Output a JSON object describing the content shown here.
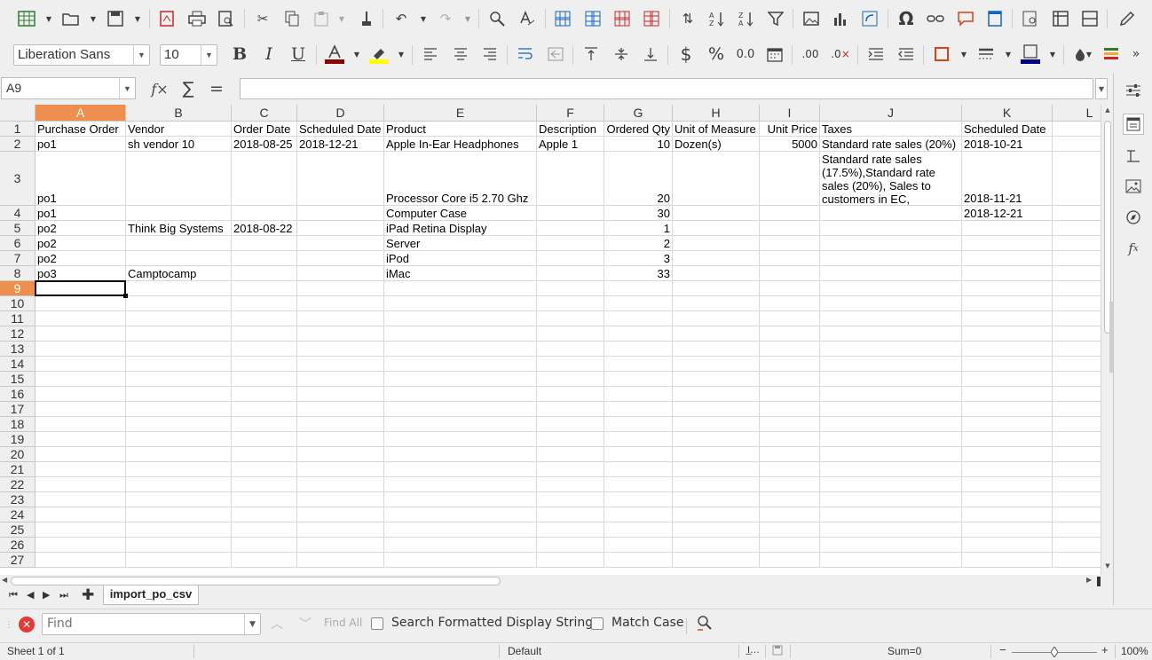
{
  "toolbar": {
    "font_name": "Liberation Sans",
    "font_size": "10"
  },
  "formula_bar": {
    "name_box": "A9",
    "function_wizard_glyph": "f×",
    "sum_glyph": "∑",
    "formula_glyph": "=",
    "content": ""
  },
  "sheet": {
    "columns": [
      "A",
      "B",
      "C",
      "D",
      "E",
      "F",
      "G",
      "H",
      "I",
      "J",
      "K",
      "L"
    ],
    "selected_column": "A",
    "selected_row": "9",
    "rows": [
      {
        "num": "1",
        "cells": [
          "Purchase Order",
          "Vendor",
          "Order Date",
          "Scheduled Date",
          "Product",
          "Description",
          "Ordered Qty",
          "Unit of Measure",
          "Unit Price",
          "Taxes",
          "Scheduled Date",
          ""
        ]
      },
      {
        "num": "2",
        "cells": [
          "po1",
          "sh vendor 10",
          "2018-08-25",
          "2018-12-21",
          "Apple In-Ear Headphones",
          "Apple 1",
          "10",
          "Dozen(s)",
          "5000",
          "Standard rate sales (20%)",
          "2018-10-21",
          ""
        ]
      },
      {
        "num": "3",
        "cells": [
          "po1",
          "",
          "",
          "",
          "Processor Core i5 2.70 Ghz",
          "",
          "20",
          "",
          "",
          "Standard rate sales (17.5%),Standard rate sales (20%),   Sales to customers in EC,",
          "2018-11-21",
          ""
        ]
      },
      {
        "num": "4",
        "cells": [
          "po1",
          "",
          "",
          "",
          "Computer Case",
          "",
          "30",
          "",
          "",
          "",
          "2018-12-21",
          ""
        ]
      },
      {
        "num": "5",
        "cells": [
          "po2",
          "Think Big Systems",
          "2018-08-22",
          "",
          "iPad Retina Display",
          "",
          "1",
          "",
          "",
          "",
          "",
          ""
        ]
      },
      {
        "num": "6",
        "cells": [
          "po2",
          "",
          "",
          "",
          "Server",
          "",
          "2",
          "",
          "",
          "",
          "",
          ""
        ]
      },
      {
        "num": "7",
        "cells": [
          "po2",
          "",
          "",
          "",
          "iPod",
          "",
          "3",
          "",
          "",
          "",
          "",
          ""
        ]
      },
      {
        "num": "8",
        "cells": [
          "po3",
          "Camptocamp",
          "",
          "",
          "iMac",
          "",
          "33",
          "",
          "",
          "",
          "",
          ""
        ]
      },
      {
        "num": "9",
        "cells": [
          "",
          "",
          "",
          "",
          "",
          "",
          "",
          "",
          "",
          "",
          "",
          ""
        ]
      },
      {
        "num": "10",
        "cells": []
      },
      {
        "num": "11",
        "cells": []
      },
      {
        "num": "12",
        "cells": []
      },
      {
        "num": "13",
        "cells": []
      },
      {
        "num": "14",
        "cells": []
      },
      {
        "num": "15",
        "cells": []
      },
      {
        "num": "16",
        "cells": []
      },
      {
        "num": "17",
        "cells": []
      },
      {
        "num": "18",
        "cells": []
      },
      {
        "num": "19",
        "cells": []
      },
      {
        "num": "20",
        "cells": []
      },
      {
        "num": "21",
        "cells": []
      },
      {
        "num": "22",
        "cells": []
      },
      {
        "num": "23",
        "cells": []
      },
      {
        "num": "24",
        "cells": []
      },
      {
        "num": "25",
        "cells": []
      },
      {
        "num": "26",
        "cells": []
      },
      {
        "num": "27",
        "cells": []
      }
    ],
    "numeric_columns": [
      6,
      8
    ]
  },
  "tabs": {
    "active": "import_po_csv"
  },
  "find": {
    "placeholder": "Find",
    "find_all": "Find All",
    "search_formatted": "Search Formatted Display String",
    "match_case": "Match Case"
  },
  "status": {
    "sheet": "Sheet 1 of 1",
    "page_style": "Default",
    "sum": "Sum=0",
    "zoom": "100%"
  },
  "colors": {
    "selection": "#ef8f4f",
    "font_color_bar": "#8b0000",
    "highlight_bar": "#ffff00",
    "border_color_bar": "#000080"
  }
}
